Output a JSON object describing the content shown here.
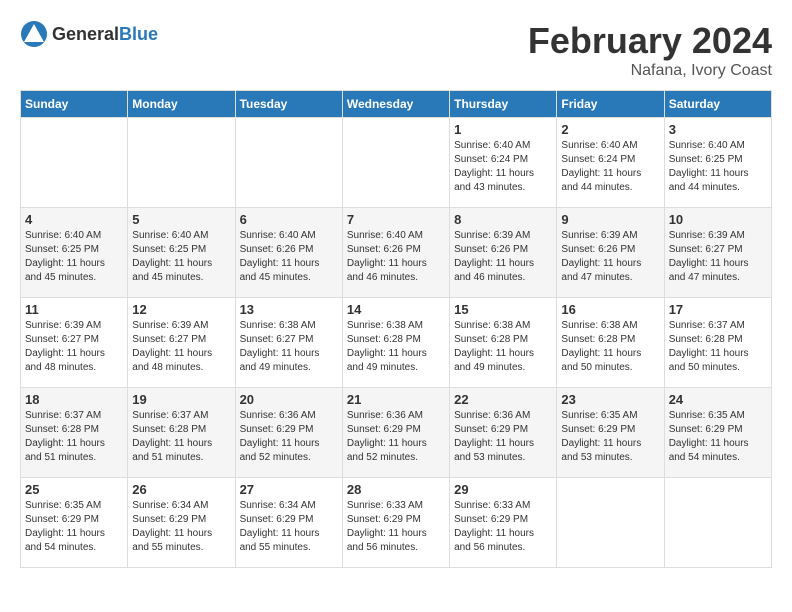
{
  "logo": {
    "general": "General",
    "blue": "Blue"
  },
  "title": "February 2024",
  "location": "Nafana, Ivory Coast",
  "days_of_week": [
    "Sunday",
    "Monday",
    "Tuesday",
    "Wednesday",
    "Thursday",
    "Friday",
    "Saturday"
  ],
  "weeks": [
    [
      {
        "day": "",
        "info": ""
      },
      {
        "day": "",
        "info": ""
      },
      {
        "day": "",
        "info": ""
      },
      {
        "day": "",
        "info": ""
      },
      {
        "day": "1",
        "info": "Sunrise: 6:40 AM\nSunset: 6:24 PM\nDaylight: 11 hours and 43 minutes."
      },
      {
        "day": "2",
        "info": "Sunrise: 6:40 AM\nSunset: 6:24 PM\nDaylight: 11 hours and 44 minutes."
      },
      {
        "day": "3",
        "info": "Sunrise: 6:40 AM\nSunset: 6:25 PM\nDaylight: 11 hours and 44 minutes."
      }
    ],
    [
      {
        "day": "4",
        "info": "Sunrise: 6:40 AM\nSunset: 6:25 PM\nDaylight: 11 hours and 45 minutes."
      },
      {
        "day": "5",
        "info": "Sunrise: 6:40 AM\nSunset: 6:25 PM\nDaylight: 11 hours and 45 minutes."
      },
      {
        "day": "6",
        "info": "Sunrise: 6:40 AM\nSunset: 6:26 PM\nDaylight: 11 hours and 45 minutes."
      },
      {
        "day": "7",
        "info": "Sunrise: 6:40 AM\nSunset: 6:26 PM\nDaylight: 11 hours and 46 minutes."
      },
      {
        "day": "8",
        "info": "Sunrise: 6:39 AM\nSunset: 6:26 PM\nDaylight: 11 hours and 46 minutes."
      },
      {
        "day": "9",
        "info": "Sunrise: 6:39 AM\nSunset: 6:26 PM\nDaylight: 11 hours and 47 minutes."
      },
      {
        "day": "10",
        "info": "Sunrise: 6:39 AM\nSunset: 6:27 PM\nDaylight: 11 hours and 47 minutes."
      }
    ],
    [
      {
        "day": "11",
        "info": "Sunrise: 6:39 AM\nSunset: 6:27 PM\nDaylight: 11 hours and 48 minutes."
      },
      {
        "day": "12",
        "info": "Sunrise: 6:39 AM\nSunset: 6:27 PM\nDaylight: 11 hours and 48 minutes."
      },
      {
        "day": "13",
        "info": "Sunrise: 6:38 AM\nSunset: 6:27 PM\nDaylight: 11 hours and 49 minutes."
      },
      {
        "day": "14",
        "info": "Sunrise: 6:38 AM\nSunset: 6:28 PM\nDaylight: 11 hours and 49 minutes."
      },
      {
        "day": "15",
        "info": "Sunrise: 6:38 AM\nSunset: 6:28 PM\nDaylight: 11 hours and 49 minutes."
      },
      {
        "day": "16",
        "info": "Sunrise: 6:38 AM\nSunset: 6:28 PM\nDaylight: 11 hours and 50 minutes."
      },
      {
        "day": "17",
        "info": "Sunrise: 6:37 AM\nSunset: 6:28 PM\nDaylight: 11 hours and 50 minutes."
      }
    ],
    [
      {
        "day": "18",
        "info": "Sunrise: 6:37 AM\nSunset: 6:28 PM\nDaylight: 11 hours and 51 minutes."
      },
      {
        "day": "19",
        "info": "Sunrise: 6:37 AM\nSunset: 6:28 PM\nDaylight: 11 hours and 51 minutes."
      },
      {
        "day": "20",
        "info": "Sunrise: 6:36 AM\nSunset: 6:29 PM\nDaylight: 11 hours and 52 minutes."
      },
      {
        "day": "21",
        "info": "Sunrise: 6:36 AM\nSunset: 6:29 PM\nDaylight: 11 hours and 52 minutes."
      },
      {
        "day": "22",
        "info": "Sunrise: 6:36 AM\nSunset: 6:29 PM\nDaylight: 11 hours and 53 minutes."
      },
      {
        "day": "23",
        "info": "Sunrise: 6:35 AM\nSunset: 6:29 PM\nDaylight: 11 hours and 53 minutes."
      },
      {
        "day": "24",
        "info": "Sunrise: 6:35 AM\nSunset: 6:29 PM\nDaylight: 11 hours and 54 minutes."
      }
    ],
    [
      {
        "day": "25",
        "info": "Sunrise: 6:35 AM\nSunset: 6:29 PM\nDaylight: 11 hours and 54 minutes."
      },
      {
        "day": "26",
        "info": "Sunrise: 6:34 AM\nSunset: 6:29 PM\nDaylight: 11 hours and 55 minutes."
      },
      {
        "day": "27",
        "info": "Sunrise: 6:34 AM\nSunset: 6:29 PM\nDaylight: 11 hours and 55 minutes."
      },
      {
        "day": "28",
        "info": "Sunrise: 6:33 AM\nSunset: 6:29 PM\nDaylight: 11 hours and 56 minutes."
      },
      {
        "day": "29",
        "info": "Sunrise: 6:33 AM\nSunset: 6:29 PM\nDaylight: 11 hours and 56 minutes."
      },
      {
        "day": "",
        "info": ""
      },
      {
        "day": "",
        "info": ""
      }
    ]
  ]
}
